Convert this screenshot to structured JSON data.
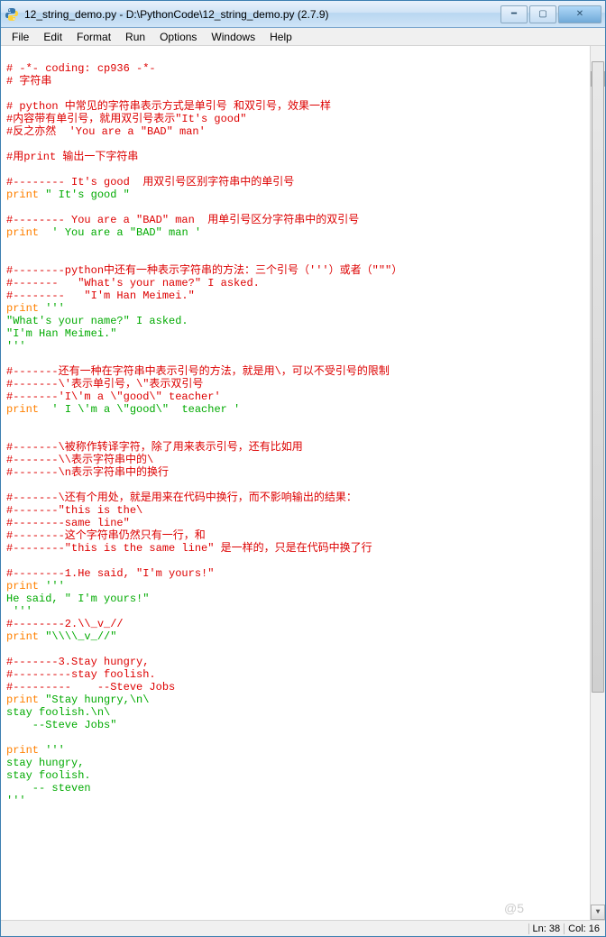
{
  "window": {
    "title": "12_string_demo.py - D:\\PythonCode\\12_string_demo.py (2.7.9)"
  },
  "menu": {
    "items": [
      "File",
      "Edit",
      "Format",
      "Run",
      "Options",
      "Windows",
      "Help"
    ]
  },
  "status": {
    "ln_label": "Ln: 38",
    "col_label": "Col: 16"
  },
  "watermark": "@5",
  "code": {
    "l1": "# -*- coding: cp936 -*-",
    "l2": "# 字符串",
    "l3": "",
    "l4": "# python 中常见的字符串表示方式是单引号 和双引号，效果一样",
    "l5": "#内容带有单引号，就用双引号表示\"It's good\"",
    "l6": "#反之亦然  'You are a \"BAD\" man'",
    "l7": "",
    "l8": "#用print 输出一下字符串",
    "l9": "",
    "l10": "#-------- It's good  用双引号区别字符串中的单引号",
    "l11_kw": "print",
    "l11_str": " \" It's good \"",
    "l12": "",
    "l13": "#-------- You are a \"BAD\" man  用单引号区分字符串中的双引号",
    "l14_kw": "print",
    "l14_str": "  ' You are a \"BAD\" man '",
    "l15": "",
    "l16": "",
    "l17": "#--------python中还有一种表示字符串的方法：三个引号（'''）或者（\"\"\"）",
    "l18": "#-------   \"What's your name?\" I asked.",
    "l19": "#--------   \"I'm Han Meimei.\"",
    "l20_kw": "print",
    "l20_str": " '''",
    "l21_str": "\"What's your name?\" I asked.",
    "l22_str": "\"I'm Han Meimei.\"",
    "l23_str": "'''",
    "l24": "",
    "l25": "#-------还有一种在字符串中表示引号的方法，就是用\\，可以不受引号的限制",
    "l26": "#-------\\'表示单引号，\\\"表示双引号",
    "l27": "#-------'I\\'m a \\\"good\\\" teacher'",
    "l28_kw": "print",
    "l28_str": "  ' I \\'m a \\\"good\\\"  teacher '",
    "l29": "",
    "l30": "",
    "l31": "#-------\\被称作转译字符，除了用来表示引号，还有比如用",
    "l32": "#-------\\\\表示字符串中的\\",
    "l33": "#-------\\n表示字符串中的换行",
    "l34": "",
    "l35": "#-------\\还有个用处，就是用来在代码中换行，而不影响输出的结果：",
    "l36": "#-------\"this is the\\",
    "l37": "#--------same line\"",
    "l38": "#--------这个字符串仍然只有一行，和",
    "l39": "#--------\"this is the same line\" 是一样的，只是在代码中换了行",
    "l40": "",
    "l41": "#--------1.He said, \"I'm yours!\"",
    "l42_kw": "print",
    "l42_str": " '''",
    "l43_str": "He said, \" I'm yours!\"",
    "l44_str": " '''",
    "l45": "#--------2.\\\\_v_//",
    "l46_kw": "print",
    "l46_str": " \"\\\\\\\\_v_//\"",
    "l47": "",
    "l48": "#-------3.Stay hungry,",
    "l49": "#---------stay foolish.",
    "l50": "#---------    --Steve Jobs",
    "l51_kw": "print",
    "l51_str": " \"Stay hungry,\\n\\",
    "l52_str": "stay foolish.\\n\\",
    "l53_str": "    --Steve Jobs\"",
    "l54": "",
    "l55_kw": "print",
    "l55_str": " '''",
    "l56_str": "stay hungry,",
    "l57_str": "stay foolish.",
    "l58_str": "    -- steven",
    "l59_str": "'''"
  }
}
